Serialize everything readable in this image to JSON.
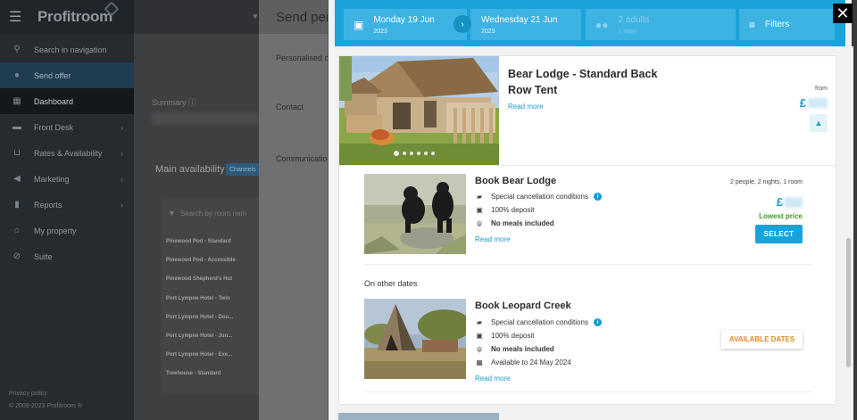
{
  "sidebar": {
    "logo": "Profitroom",
    "items": [
      {
        "label": "Search in navigation",
        "icon": "search-icon"
      },
      {
        "label": "Send offer",
        "icon": "send-offer-icon"
      },
      {
        "label": "Dashboard",
        "icon": "dashboard-icon"
      },
      {
        "label": "Front Desk",
        "icon": "bed-icon"
      },
      {
        "label": "Rates & Availability",
        "icon": "cart-icon"
      },
      {
        "label": "Marketing",
        "icon": "megaphone-icon"
      },
      {
        "label": "Reports",
        "icon": "chart-icon"
      },
      {
        "label": "My property",
        "icon": "home-icon"
      },
      {
        "label": "Suite",
        "icon": "suite-icon"
      }
    ],
    "footer_privacy": "Privacy policy",
    "footer_copy": "© 2009-2023 Profitroom ®"
  },
  "background": {
    "summary_label": "Summary",
    "main_availability": "Main availability",
    "channel_button": "Channels",
    "room_search_placeholder": "Search by room nam",
    "rooms": [
      "Pinewood Pod - Standard",
      "Pinewood Pod - Accessible",
      "Pinewood Shepherd's Hut",
      "Port Lympne Hotel - Twin",
      "Port Lympne Hotel - Dou...",
      "Port Lympne Hotel - Jun...",
      "Port Lympne Hotel - Exe...",
      "Treehouse - Standard"
    ]
  },
  "send_panel": {
    "title": "Send pers",
    "rows": [
      "Personalised o",
      "Contact",
      "Communication"
    ]
  },
  "modal": {
    "topbar": {
      "checkin_date": "Monday 19 Jun",
      "checkin_year": "2023",
      "checkout_date": "Wednesday 21 Jun",
      "checkout_year": "2023",
      "guests": "2 adults",
      "guests_sub": "1 room",
      "filters": "Filters"
    },
    "room": {
      "title": "Bear Lodge - Standard Back Row Tent",
      "read_more": "Read more",
      "from_label": "from",
      "currency": "£"
    },
    "offer": {
      "title": "Book Bear Lodge",
      "features": [
        "Special cancellation conditions",
        "100% deposit",
        "No meals included"
      ],
      "read_more": "Read more",
      "occupancy": "2 people, 2 nights, 1 room",
      "currency": "£",
      "lowest_price": "Lowest price",
      "select": "SELECT"
    },
    "other_dates_label": "On other dates",
    "offer2": {
      "title": "Book Leopard Creek",
      "features": [
        "Special cancellation conditions",
        "100% deposit",
        "No meals included",
        "Available to 24 May 2024"
      ],
      "read_more": "Read more",
      "available_dates": "AVAILABLE DATES"
    },
    "close": "✕"
  },
  "colors": {
    "accent": "#1aa3da",
    "green": "#3f9a28",
    "orange": "#e08a1e"
  }
}
